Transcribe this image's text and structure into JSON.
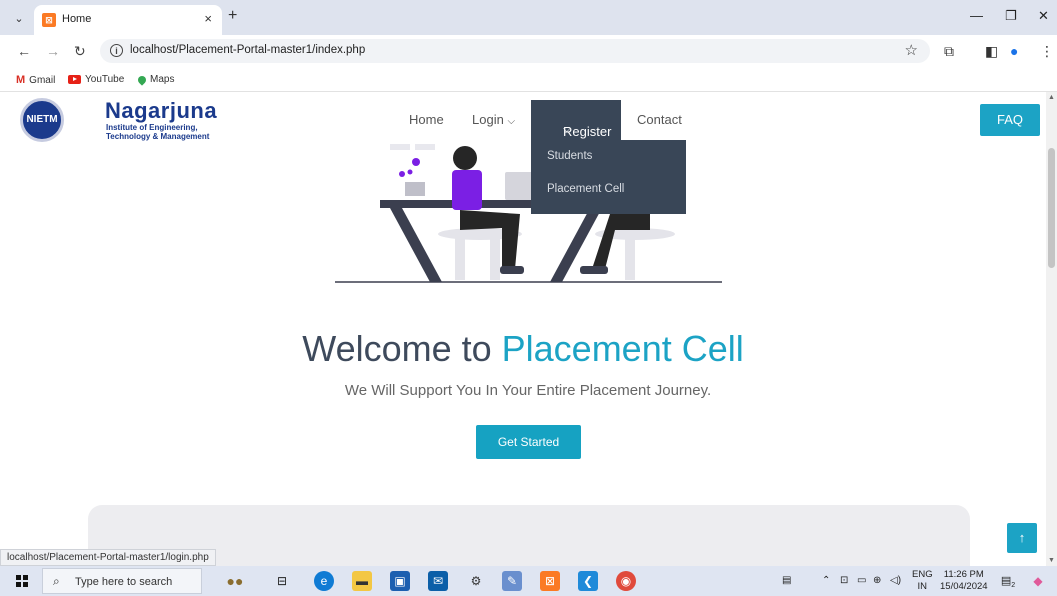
{
  "browser": {
    "tab_title": "Home",
    "tab_close": "×",
    "new_tab": "+",
    "url": "localhost/Placement-Portal-master1/index.php",
    "bookmarks": [
      {
        "label": "Gmail",
        "icon": "gmail-icon"
      },
      {
        "label": "YouTube",
        "icon": "youtube-icon"
      },
      {
        "label": "Maps",
        "icon": "maps-icon"
      }
    ],
    "status_url": "localhost/Placement-Portal-master1/login.php"
  },
  "logo": {
    "seal_text": "NIETM",
    "name": "Nagarjuna",
    "subtitle_line1": "Institute of Engineering,",
    "subtitle_line2": "Technology & Management"
  },
  "nav": {
    "home": "Home",
    "login": "Login",
    "register": "Register",
    "contact": "Contact",
    "faq": "FAQ",
    "register_menu": [
      "Students",
      "Placement Cell"
    ]
  },
  "hero": {
    "title_prefix": "Welcome to ",
    "title_highlight": "Placement Cell",
    "subtitle": "We Will Support You In Your Entire Placement Journey.",
    "cta": "Get Started"
  },
  "taskbar": {
    "search_placeholder": "Type here to search",
    "lang_top": "ENG",
    "lang_bottom": "IN",
    "time": "11:26 PM",
    "date": "15/04/2024",
    "notif_count": "2"
  },
  "colors": {
    "accent": "#1ca3c5",
    "nav_dark": "#394657",
    "brand": "#1b3a8c"
  }
}
